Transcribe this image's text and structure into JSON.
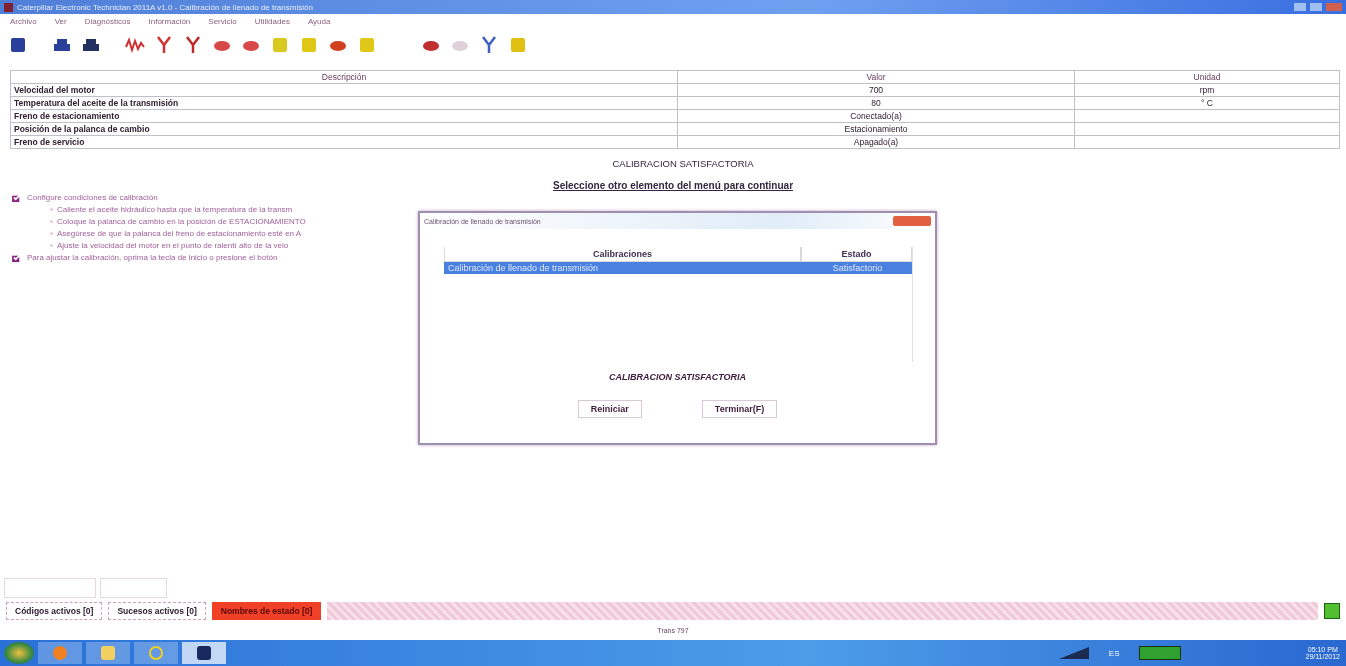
{
  "window": {
    "title": "Caterpillar Electronic Technician 2011A v1.0 - Calibración de llenado de transmisión"
  },
  "menu": [
    "Archivo",
    "Ver",
    "Diagnósticos",
    "Información",
    "Servicio",
    "Utilidades",
    "Ayuda"
  ],
  "table": {
    "columns": [
      "Descripción",
      "Valor",
      "Unidad"
    ],
    "rows": [
      {
        "description": "Velocidad del motor",
        "value": "700",
        "unit": "rpm"
      },
      {
        "description": "Temperatura del aceite de la transmisión",
        "value": "80",
        "unit": "° C"
      },
      {
        "description": "Freno de estacionamiento",
        "value": "Conectado(a)",
        "unit": ""
      },
      {
        "description": "Posición de la palanca de cambio",
        "value": "Estacionamiento",
        "unit": ""
      },
      {
        "description": "Freno de servicio",
        "value": "Apagado(a)",
        "unit": ""
      }
    ]
  },
  "status_message": "CALIBRACION SATISFACTORIA",
  "prompt": "Seleccione otro elemento del menú para continuar",
  "instructions": [
    {
      "kind": "check",
      "text": "Configure condiciones de calibración"
    },
    {
      "kind": "sub",
      "text": "Caliente el aceite hidráulico hasta que la temperatura de la transm"
    },
    {
      "kind": "sub",
      "text": "Coloque la palanca de cambio en la posición de ESTACIONAMIENTO"
    },
    {
      "kind": "sub",
      "text": "Asegúrese de que la palanca del freno de estacionamiento esté en A"
    },
    {
      "kind": "sub",
      "text": "Ajuste la velocidad del motor en el punto de ralentí alto de la velo"
    },
    {
      "kind": "check",
      "text": "Para ajustar la calibración, oprima la tecla de inicio o presione el botón"
    }
  ],
  "dialog": {
    "title": "Calibración de llenado de transmisión",
    "columns": [
      "Calibraciones",
      "Estado"
    ],
    "rows": [
      {
        "name": "Calibración de llenado de transmisión",
        "status": "Satisfactorio",
        "selected": true
      }
    ],
    "message": "CALIBRACION SATISFACTORIA",
    "buttons": [
      "Reiniciar",
      "Terminar(F)"
    ]
  },
  "bottom_tabs": [
    {
      "label": "Códigos activos [0]",
      "kind": "normal"
    },
    {
      "label": "Sucesos activos [0]",
      "kind": "normal"
    },
    {
      "label": "Nombres de estado [0]",
      "kind": "alert"
    }
  ],
  "status_bar": "Trans 797",
  "taskbar": {
    "language": "ES",
    "time": "05:10 PM",
    "date": "29/11/2012"
  }
}
